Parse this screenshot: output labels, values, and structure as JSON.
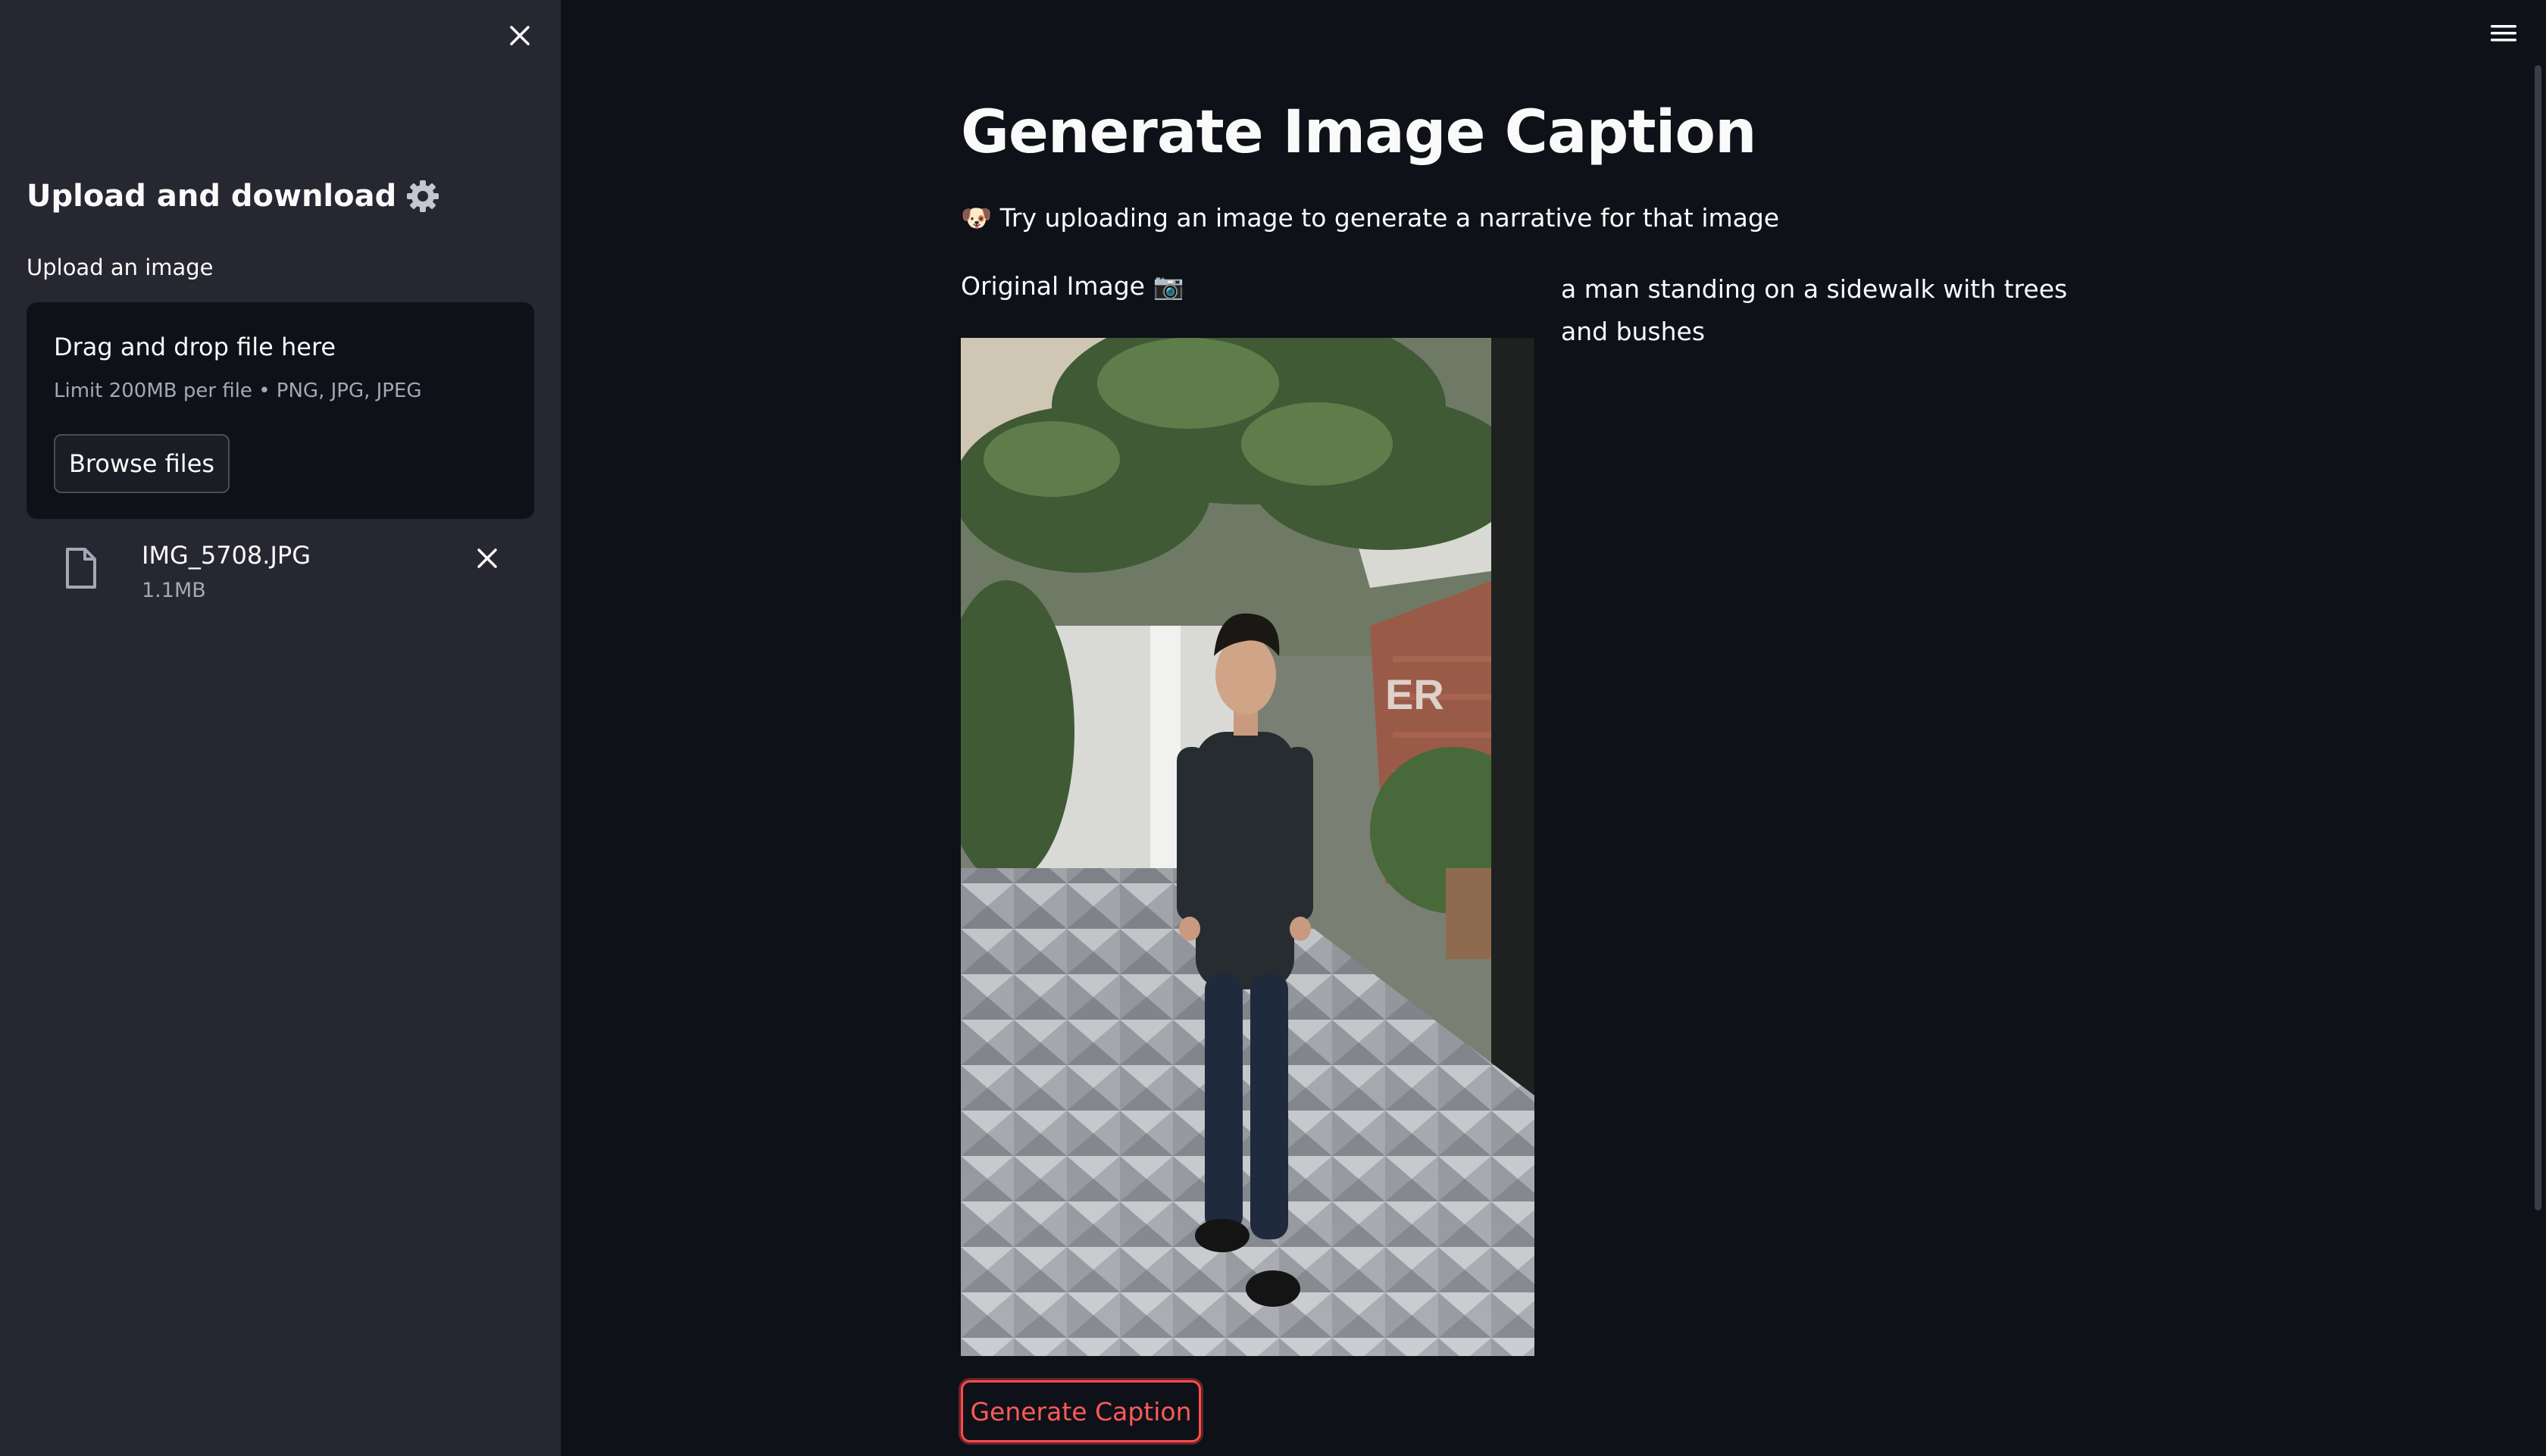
{
  "sidebar": {
    "title": "Upload and download",
    "title_icon": "gear-icon",
    "upload_label": "Upload an image",
    "dropzone": {
      "title": "Drag and drop file here",
      "limit": "Limit 200MB per file • PNG, JPG, JPEG",
      "browse_label": "Browse files"
    },
    "file": {
      "name": "IMG_5708.JPG",
      "size": "1.1MB"
    }
  },
  "main": {
    "title": "Generate Image Caption",
    "subtitle": "🐶 Try uploading an image to generate a narrative for that image",
    "image_label": "Original Image 📷",
    "caption": "a man standing on a sidewalk with trees and bushes",
    "generate_label": "Generate Caption"
  },
  "colors": {
    "background": "#0e1117",
    "sidebar": "#262730",
    "accent": "#ff4b4b",
    "text": "#fafafa"
  }
}
